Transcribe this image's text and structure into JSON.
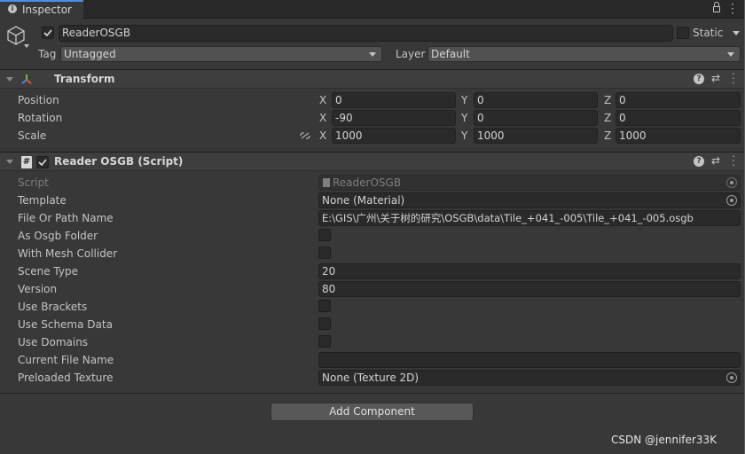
{
  "tab": {
    "title": "Inspector"
  },
  "object": {
    "name": "ReaderOSGB",
    "active": true,
    "static_label": "Static",
    "tag_label": "Tag",
    "tag_value": "Untagged",
    "layer_label": "Layer",
    "layer_value": "Default"
  },
  "transform": {
    "title": "Transform",
    "rows": [
      {
        "label": "Position",
        "x": "0",
        "y": "0",
        "z": "0"
      },
      {
        "label": "Rotation",
        "x": "-90",
        "y": "0",
        "z": "0"
      },
      {
        "label": "Scale",
        "x": "1000",
        "y": "1000",
        "z": "1000"
      }
    ],
    "axis": {
      "x": "X",
      "y": "Y",
      "z": "Z"
    }
  },
  "script": {
    "title": "Reader OSGB (Script)",
    "fields": {
      "script_label": "Script",
      "script_value": "ReaderOSGB",
      "template_label": "Template",
      "template_value": "None (Material)",
      "file_label": "File Or Path Name",
      "file_value": "E:\\GIS\\广州\\关于树的研究\\OSGB\\data\\Tile_+041_-005\\Tile_+041_-005.osgb",
      "as_folder_label": "As Osgb Folder",
      "mesh_collider_label": "With Mesh Collider",
      "scene_type_label": "Scene Type",
      "scene_type_value": "20",
      "version_label": "Version",
      "version_value": "80",
      "brackets_label": "Use Brackets",
      "schema_label": "Use Schema Data",
      "domains_label": "Use Domains",
      "current_file_label": "Current File Name",
      "current_file_value": "",
      "preloaded_label": "Preloaded Texture",
      "preloaded_value": "None (Texture 2D)"
    }
  },
  "add_component": "Add Component",
  "watermark": "CSDN @jennifer33K"
}
